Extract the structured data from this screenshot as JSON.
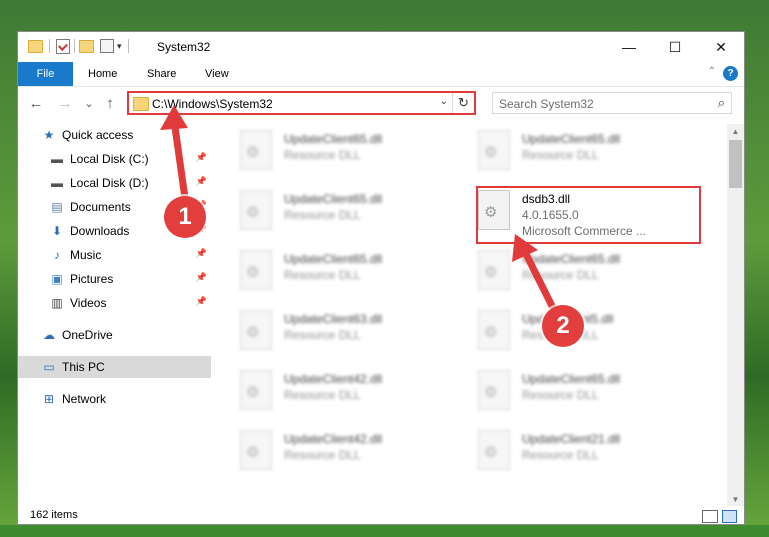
{
  "titlebar": {
    "title": "System32",
    "minimize": "—",
    "maximize": "☐",
    "close": "✕"
  },
  "ribbon": {
    "file": "File",
    "tabs": [
      "Home",
      "Share",
      "View"
    ],
    "help": "?",
    "collapse": "⌃"
  },
  "nav": {
    "back": "←",
    "forward": "→",
    "recent": "⌄",
    "up": "↑"
  },
  "address": {
    "path": "C:\\Windows\\System32",
    "dropdown": "⌄",
    "refresh": "↻"
  },
  "search": {
    "placeholder": "Search System32",
    "icon": "⌕"
  },
  "sidebar": {
    "items": [
      {
        "label": "Quick access",
        "icon": "star-icon",
        "glyph": "★",
        "color": "#2a6fb6",
        "pinned": false
      },
      {
        "label": "Local Disk (C:)",
        "icon": "drive-icon",
        "glyph": "▬",
        "color": "#555",
        "pinned": true
      },
      {
        "label": "Local Disk (D:)",
        "icon": "drive-icon",
        "glyph": "▬",
        "color": "#555",
        "pinned": true
      },
      {
        "label": "Documents",
        "icon": "document-icon",
        "glyph": "▤",
        "color": "#5b7fa6",
        "pinned": true
      },
      {
        "label": "Downloads",
        "icon": "download-icon",
        "glyph": "⬇",
        "color": "#2a6fb6",
        "pinned": true
      },
      {
        "label": "Music",
        "icon": "music-icon",
        "glyph": "♪",
        "color": "#2a6fb6",
        "pinned": true
      },
      {
        "label": "Pictures",
        "icon": "pictures-icon",
        "glyph": "▣",
        "color": "#3f7fbf",
        "pinned": true
      },
      {
        "label": "Videos",
        "icon": "video-icon",
        "glyph": "▥",
        "color": "#444",
        "pinned": true
      },
      {
        "label": "OneDrive",
        "icon": "cloud-icon",
        "glyph": "☁",
        "color": "#2a6fb6",
        "pinned": false
      },
      {
        "label": "This PC",
        "icon": "computer-icon",
        "glyph": "▭",
        "color": "#2a6fb6",
        "pinned": false,
        "selected": true
      },
      {
        "label": "Network",
        "icon": "network-icon",
        "glyph": "⊞",
        "color": "#2a6fb6",
        "pinned": false
      }
    ],
    "pin_glyph": "📌"
  },
  "files": {
    "left": [
      {
        "name": "UpdateClient65.dll",
        "type": "Resource DLL"
      },
      {
        "name": "UpdateClient65.dll",
        "type": "Resource DLL"
      },
      {
        "name": "UpdateClient65.dll",
        "type": "Resource DLL"
      },
      {
        "name": "UpdateClient63.dll",
        "type": "Resource DLL"
      },
      {
        "name": "UpdateClient42.dll",
        "type": "Resource DLL"
      },
      {
        "name": "UpdateClient42.dll",
        "type": "Resource DLL"
      }
    ],
    "right": [
      {
        "name": "UpdateClient65.dll",
        "type": "Resource DLL"
      },
      {
        "name": "UpdateClient65.dll",
        "type": "Resource DLL"
      },
      {
        "name": "UpdateClient5.dll",
        "type": "Resource DLL"
      },
      {
        "name": "UpdateClient65.dll",
        "type": "Resource DLL"
      },
      {
        "name": "UpdateClient21.dll",
        "type": "Resource DLL"
      }
    ],
    "highlighted": {
      "name": "dsdb3.dll",
      "version": "4.0.1655.0",
      "company": "Microsoft Commerce ..."
    }
  },
  "status": {
    "count": "162 items"
  },
  "annotations": {
    "step1": "1",
    "step2": "2",
    "color": "#e13a3a"
  },
  "scrollbar": {
    "up": "▲",
    "down": "▼"
  }
}
